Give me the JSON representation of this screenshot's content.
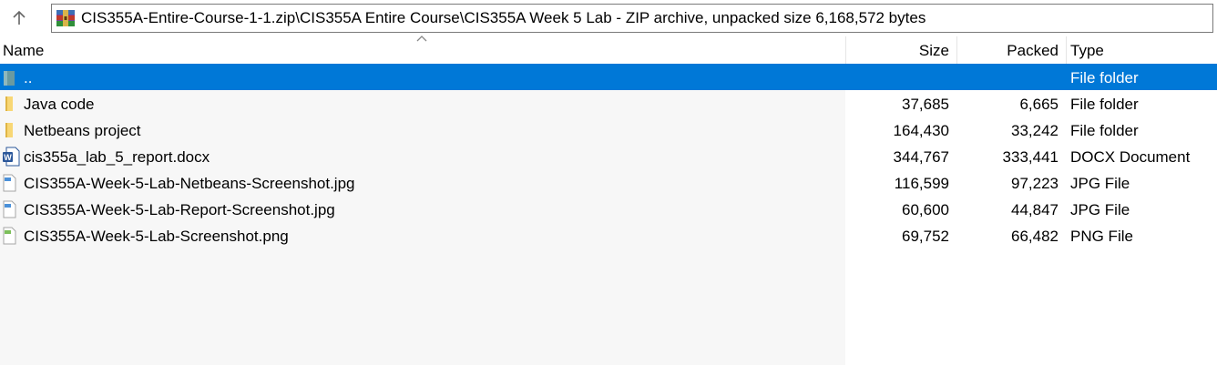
{
  "address": {
    "path": "CIS355A-Entire-Course-1-1.zip\\CIS355A Entire Course\\CIS355A Week 5 Lab - ZIP archive, unpacked size 6,168,572 bytes",
    "up_icon": "up-arrow-icon",
    "archive_icon": "winrar-archive-icon"
  },
  "columns": {
    "name": "Name",
    "size": "Size",
    "packed": "Packed",
    "type": "Type",
    "sorted_by": "name"
  },
  "rows": [
    {
      "name": "..",
      "size": "",
      "packed": "",
      "type": "File folder",
      "icon": "parent-folder-icon",
      "selected": true
    },
    {
      "name": "Java code",
      "size": "37,685",
      "packed": "6,665",
      "type": "File folder",
      "icon": "folder-icon"
    },
    {
      "name": "Netbeans project",
      "size": "164,430",
      "packed": "33,242",
      "type": "File folder",
      "icon": "folder-icon"
    },
    {
      "name": "cis355a_lab_5_report.docx",
      "size": "344,767",
      "packed": "333,441",
      "type": "DOCX Document",
      "icon": "word-document-icon"
    },
    {
      "name": "CIS355A-Week-5-Lab-Netbeans-Screenshot.jpg",
      "size": "116,599",
      "packed": "97,223",
      "type": "JPG File",
      "icon": "jpg-file-icon"
    },
    {
      "name": "CIS355A-Week-5-Lab-Report-Screenshot.jpg",
      "size": "60,600",
      "packed": "44,847",
      "type": "JPG File",
      "icon": "jpg-file-icon"
    },
    {
      "name": "CIS355A-Week-5-Lab-Screenshot.png",
      "size": "69,752",
      "packed": "66,482",
      "type": "PNG File",
      "icon": "png-file-icon"
    }
  ],
  "colors": {
    "selection": "#0078d7",
    "folder": "#f8d775",
    "word": "#2b579a"
  }
}
